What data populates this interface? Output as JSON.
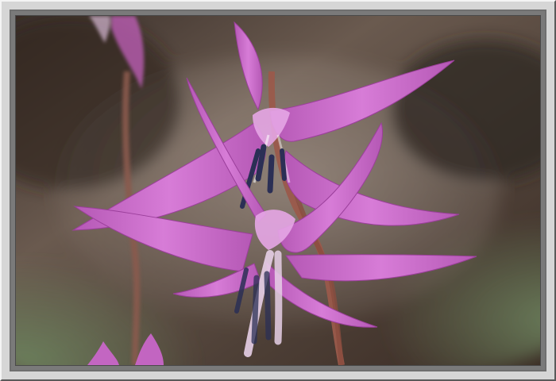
{
  "image": {
    "subject": "pink-icon",
    "colors": {
      "frame": "#d6d6d6",
      "petal_main": "#c866c8",
      "petal_light": "#e6a6e6",
      "petal_dark": "#9b3f9b",
      "anther": "#2b2f55",
      "stem": "#a05a4a",
      "bg_green": "#5f7a57",
      "bg_brown": "#6b4b3b"
    }
  }
}
